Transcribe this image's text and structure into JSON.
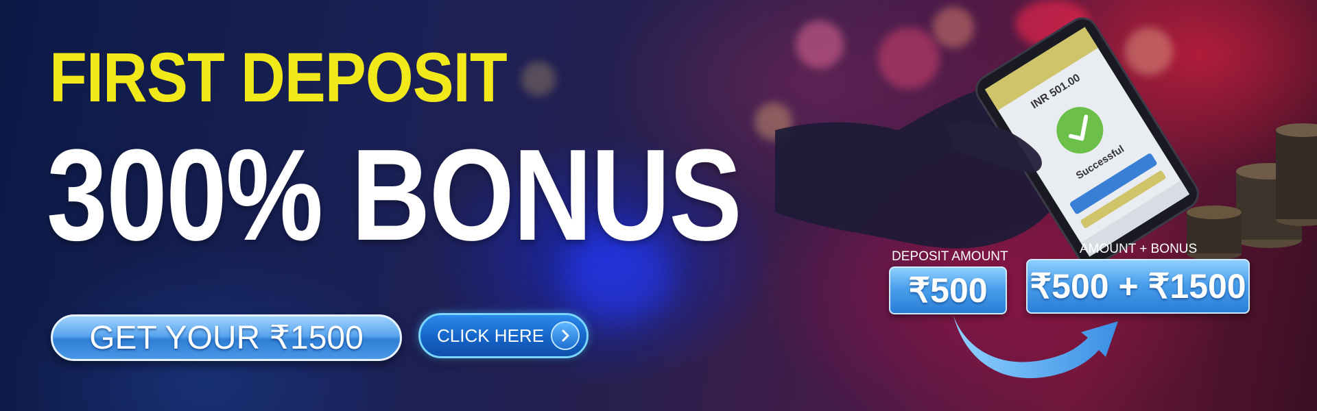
{
  "promo": {
    "headline_line1": "FIRST DEPOSIT",
    "headline_line2": "300% BONUS",
    "cta_primary": "GET YOUR ₹1500",
    "cta_secondary": "CLICK HERE"
  },
  "example": {
    "deposit_label": "DEPOSIT AMOUNT",
    "deposit_value": "₹500",
    "total_label": "AMOUNT + BONUS",
    "total_value": "₹500 + ₹1500"
  },
  "phone_screen": {
    "amount_text": "INR 501.00",
    "status_text": "Successful"
  },
  "icons": {
    "cta_arrow": "chevron-right-icon",
    "flow_arrow": "curved-arrow-icon",
    "success_mark": "check-icon"
  },
  "colors": {
    "headline_yellow": "#f2e91a",
    "headline_white": "#ffffff",
    "button_blue": "#4a9fe9",
    "button_dark_blue": "#1564c8"
  }
}
